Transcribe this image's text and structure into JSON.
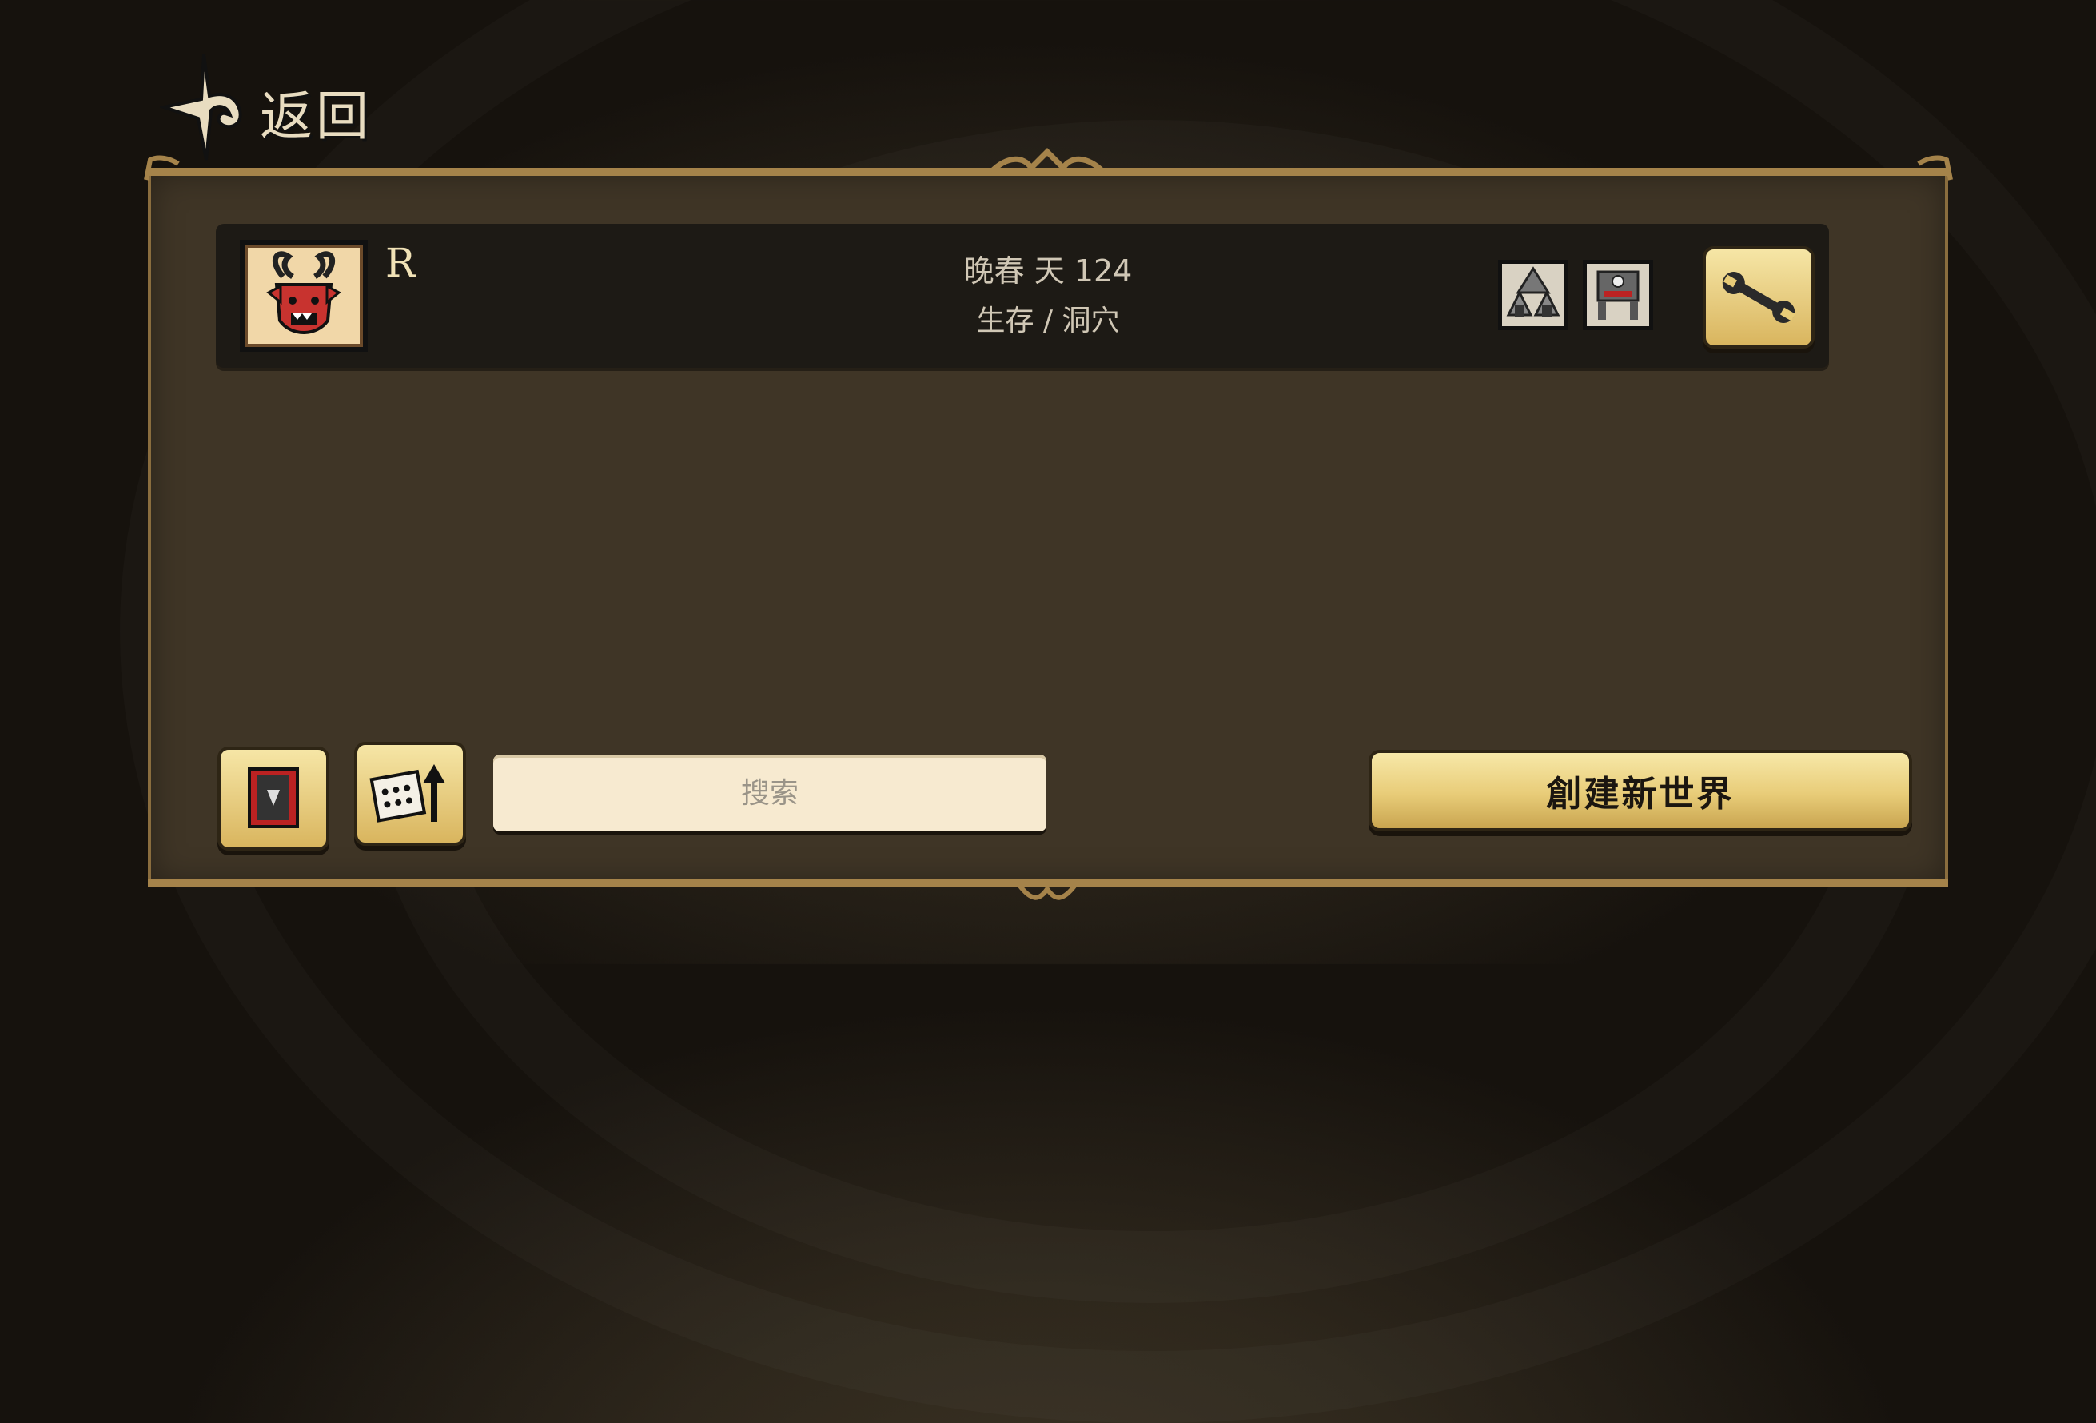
{
  "header": {
    "back_label": "返回",
    "back_icon": "ornate-arrow-left-icon"
  },
  "world": {
    "name": "R",
    "season_line": "晚春 天 124",
    "mode_line": "生存 / 洞穴",
    "portrait_icon": "red-horned-character-portrait-icon",
    "mods": [
      "mod-icon-pig-houses",
      "mod-icon-robot"
    ],
    "settings_icon": "wrench-icon"
  },
  "controls": {
    "filter_icon": "mod-filter-card-icon",
    "sort_icon": "calendar-sort-icon",
    "search_placeholder": "搜索",
    "create_label": "創建新世界"
  },
  "colors": {
    "accent_gold": "#e8cc78",
    "panel": "#3f3526",
    "row": "#1d1a15"
  }
}
